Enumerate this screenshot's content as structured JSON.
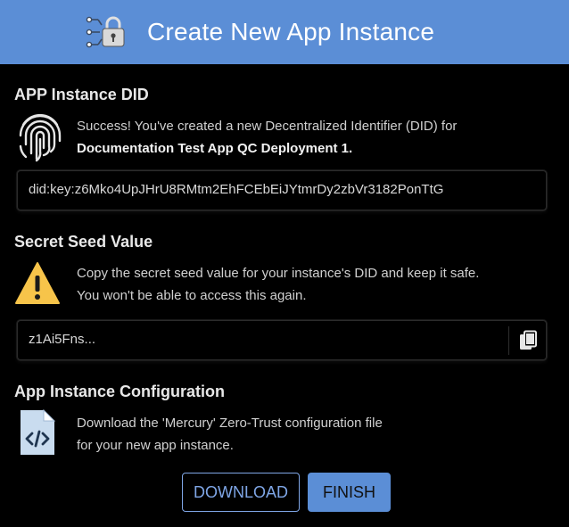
{
  "header": {
    "title": "Create New App Instance",
    "icon": "network-lock-icon",
    "color": "#5b8ed6"
  },
  "did_section": {
    "title": "APP Instance DID",
    "icon": "fingerprint-icon",
    "message_line1": "Success! You've created a new Decentralized Identifier (DID) for",
    "message_line2": "Documentation Test App QC Deployment 1.",
    "did_value": "did:key:z6Mko4UpJHrU8RMtm2EhFCEbEiJYtmrDy2zbVr3182PonTtG"
  },
  "seed_section": {
    "title": "Secret Seed Value",
    "icon": "warning-icon",
    "message_line1": "Copy the secret seed value for your instance's DID and keep it safe.",
    "message_line2": "You won't be able to access this again.",
    "seed_value": "z1Ai5Fns...",
    "copy_icon": "copy-icon"
  },
  "config_section": {
    "title": "App Instance Configuration",
    "icon": "code-file-icon",
    "message_line1": "Download the 'Mercury' Zero-Trust configuration file",
    "message_line2": "for your new app instance."
  },
  "buttons": {
    "download": "DOWNLOAD",
    "finish": "FINISH"
  }
}
